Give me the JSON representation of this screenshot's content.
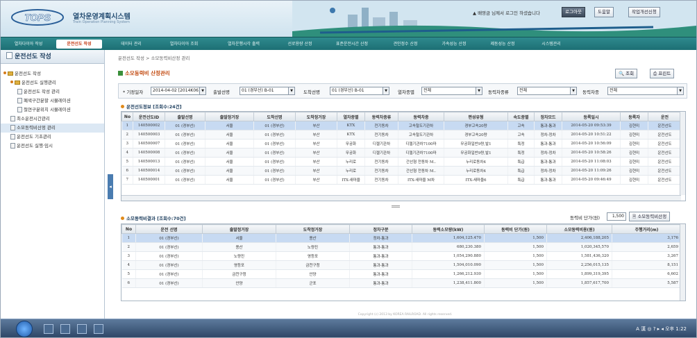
{
  "header": {
    "logo_text": "TOPS",
    "system_title": "열차운영계획시스템",
    "system_subtitle": "Train Operation Planning System",
    "user_info": "▲ 배영금 님께서 로그인 하셨습니다",
    "logout_label": "로그아웃",
    "help_label": "도움말",
    "settings_label": "작업개선신청"
  },
  "nav": {
    "items": [
      "열차다이아 작성",
      "운전선도 작성",
      "데이터 관리",
      "열차다이아 조회",
      "열차운행시각 출력",
      "선로용량 산정",
      "표준운전시간 산정",
      "견인정수 산정",
      "가속성능 산정",
      "제동성능 산정",
      "시스템관리"
    ],
    "active_index": 1
  },
  "sidebar": {
    "title": "운전선도 작성",
    "tree": [
      {
        "label": "운전선도 작성",
        "level": 0,
        "type": "folder"
      },
      {
        "label": "운전선도 실행관리",
        "level": 1,
        "type": "folder"
      },
      {
        "label": "운전선도 작성 관리",
        "level": 2,
        "type": "doc"
      },
      {
        "label": "폐색구간분할 시뮬레이션",
        "level": 2,
        "type": "doc"
      },
      {
        "label": "절연구분위치 시뮬레이션",
        "level": 2,
        "type": "doc"
      },
      {
        "label": "최소운전시간관리",
        "level": 1,
        "type": "doc"
      },
      {
        "label": "소모동력비산정 관리",
        "level": 1,
        "type": "doc",
        "selected": true
      },
      {
        "label": "운전선도 기초관리",
        "level": 1,
        "type": "doc"
      },
      {
        "label": "운전선도 실행·임시",
        "level": 1,
        "type": "doc"
      }
    ]
  },
  "main": {
    "breadcrumb": "운전선도 작성 > 소모동력비산정 관리",
    "page_title": "소모동력비 산정관리",
    "search_label": "조회",
    "print_label": "프린트",
    "filters": {
      "date_label": "* 기정일자",
      "date_value": "2014-04-02 [2014K06]",
      "depart_line_label": "출발선명",
      "depart_line_value": "01 (경부선) B-01",
      "arrive_line_label": "도착선명",
      "arrive_line_value": "01 (경부선) B-01",
      "train_type_label": "열차종별",
      "train_type_value": "전체",
      "power_type_label": "동력차종류",
      "power_type_value": "전체",
      "power_model_label": "동력차종",
      "power_model_value": "전체"
    },
    "grid1": {
      "title": "운전선도정보 [조회수:24건]",
      "columns": [
        "No",
        "운전선도ID",
        "출발선명",
        "출발정거장",
        "도착선명",
        "도착정거장",
        "열차종별",
        "동력차종류",
        "동력차종",
        "편성유형",
        "속도종별",
        "정차모드",
        "등록일시",
        "등록자",
        "운전"
      ],
      "rows": [
        [
          "1",
          "140500002",
          "01 (경부선)",
          "서울",
          "01 (경부선)",
          "부산",
          "KTX",
          "전기동차",
          "고속철도기관차",
          "경부고속20량",
          "고속",
          "통과-통과",
          "2014-05-20 09:53:39",
          "김현미",
          "운전선도"
        ],
        [
          "2",
          "140500003",
          "01 (경부선)",
          "서울",
          "01 (경부선)",
          "부산",
          "KTX",
          "전기동차",
          "고속철도기관차",
          "경부고속20량",
          "고속",
          "정차-정차",
          "2014-05-20 10:51:22",
          "김현미",
          "운전선도"
        ],
        [
          "3",
          "140500007",
          "01 (경부선)",
          "서울",
          "01 (경부선)",
          "부산",
          "무궁화",
          "디젤기관차",
          "디젤기관차7100마",
          "무궁화일반9량,발1",
          "특정",
          "통과-통과",
          "2014-05-20 10:56:09",
          "김현미",
          "운전선도"
        ],
        [
          "4",
          "140500008",
          "01 (경부선)",
          "서울",
          "01 (경부선)",
          "부산",
          "무궁화",
          "디젤기관차",
          "디젤기관차7100마",
          "무궁화일반9량,발1",
          "특정",
          "정차-정차",
          "2014-05-20 10:58:26",
          "김현미",
          "운전선도"
        ],
        [
          "5",
          "140500013",
          "01 (경부선)",
          "서울",
          "01 (경부선)",
          "부산",
          "누리로",
          "전기동차",
          "간선형 전동차 M..",
          "누리로동차4",
          "특급",
          "통과-통과",
          "2014-05-20 11:08:03",
          "김현미",
          "운전선도"
        ],
        [
          "6",
          "140500014",
          "01 (경부선)",
          "서울",
          "01 (경부선)",
          "부산",
          "누리로",
          "전기동차",
          "간선형 전동차 M..",
          "누리로동차4",
          "특급",
          "정차-정차",
          "2014-05-20 11:09:26",
          "김현미",
          "운전선도"
        ],
        [
          "7",
          "140500001",
          "01 (경부선)",
          "서울",
          "01 (경부선)",
          "부산",
          "ITX-새마을",
          "전기동차",
          "ITX-새마을 M차",
          "ITX-새마을6",
          "특급",
          "통과-통과",
          "2014-05-20 09:46:49",
          "김현미",
          "운전선도"
        ]
      ],
      "selected_row": 0
    },
    "grid2": {
      "title": "소모동력비결과 [조회수:70건]",
      "cost_label": "동력비 단가(원)",
      "cost_value": "1,500",
      "calc_label": "소모동력비산정",
      "columns": [
        "No",
        "운전 선명",
        "출발정거장",
        "도착정거장",
        "정차구분",
        "동력소모량(kW)",
        "동력비 단가(원)",
        "소모동력비용(원)",
        "주행거리(m)"
      ],
      "rows": [
        [
          "1",
          "01 (경부선)",
          "서울",
          "용산",
          "정차-통과",
          "1,604,125.470",
          "1,500",
          "2,406,188,205",
          "3,176"
        ],
        [
          "2",
          "01 (경부선)",
          "용산",
          "노량진",
          "통과-통과",
          "680,230.380",
          "1,500",
          "1,020,345,570",
          "2,659"
        ],
        [
          "3",
          "01 (경부선)",
          "노량진",
          "영등포",
          "통과-통과",
          "1,054,290.880",
          "1,500",
          "1,581,436,320",
          "3,267"
        ],
        [
          "4",
          "01 (경부선)",
          "영등포",
          "금천구청",
          "통과-통과",
          "1,504,010.090",
          "1,500",
          "2,256,015,135",
          "8,151"
        ],
        [
          "5",
          "01 (경부선)",
          "금천구청",
          "안양",
          "통과-통과",
          "1,266,212.930",
          "1,500",
          "1,899,319,395",
          "6,602"
        ],
        [
          "6",
          "01 (경부선)",
          "안양",
          "군포",
          "통과-통과",
          "1,238,411.800",
          "1,500",
          "1,857,617,700",
          "5,587"
        ]
      ],
      "selected_row": 0
    },
    "footer": "Copyright (c) 2013 by KOREA RAILROAD. All rights reserved."
  },
  "taskbar": {
    "tray_text": "A 漢 ◎ ? ▸ ◂ 오후 1:22"
  }
}
